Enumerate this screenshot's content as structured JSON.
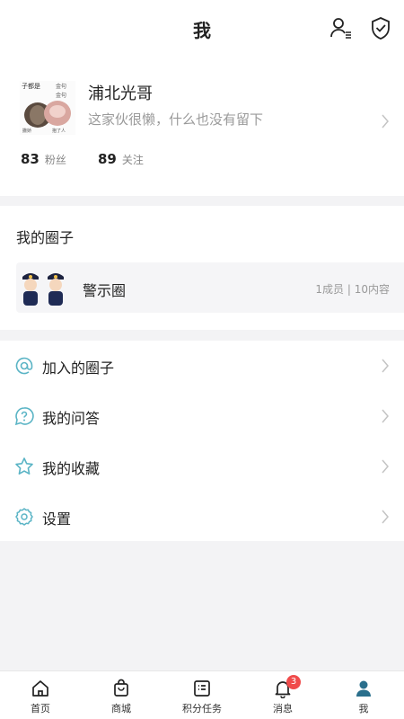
{
  "header": {
    "title": "我",
    "icons": [
      "user-list-icon",
      "shield-check-icon"
    ]
  },
  "profile": {
    "username": "浦北光哥",
    "bio": "这家伙很懒，什么也没有留下",
    "avatar_icon": "meme-avatar-image",
    "avatar_text": [
      "子都是",
      "金句",
      "金句",
      "撒娇",
      "抱了人"
    ],
    "stats": [
      {
        "value": "83",
        "label": "粉丝"
      },
      {
        "value": "89",
        "label": "关注"
      }
    ]
  },
  "circles": {
    "title": "我的圈子",
    "items": [
      {
        "name": "警示圈",
        "meta": "1成员 | 10内容",
        "icon": "police-avatars-image"
      }
    ]
  },
  "menu": {
    "items": [
      {
        "label": "加入的圈子",
        "icon": "at-sign-icon"
      },
      {
        "label": "我的问答",
        "icon": "question-bubble-icon"
      },
      {
        "label": "我的收藏",
        "icon": "star-icon"
      },
      {
        "label": "设置",
        "icon": "gear-icon"
      }
    ]
  },
  "tabbar": {
    "tabs": [
      {
        "label": "首页",
        "icon": "home-icon"
      },
      {
        "label": "商城",
        "icon": "shopping-bag-icon"
      },
      {
        "label": "积分任务",
        "icon": "task-list-icon"
      },
      {
        "label": "消息",
        "icon": "bell-icon",
        "badge": "3"
      },
      {
        "label": "我",
        "icon": "person-icon",
        "active": true
      }
    ]
  },
  "colors": {
    "accent": "#5ab4c5",
    "badge": "#f04b4b",
    "active_tab": "#2a6f8c"
  }
}
